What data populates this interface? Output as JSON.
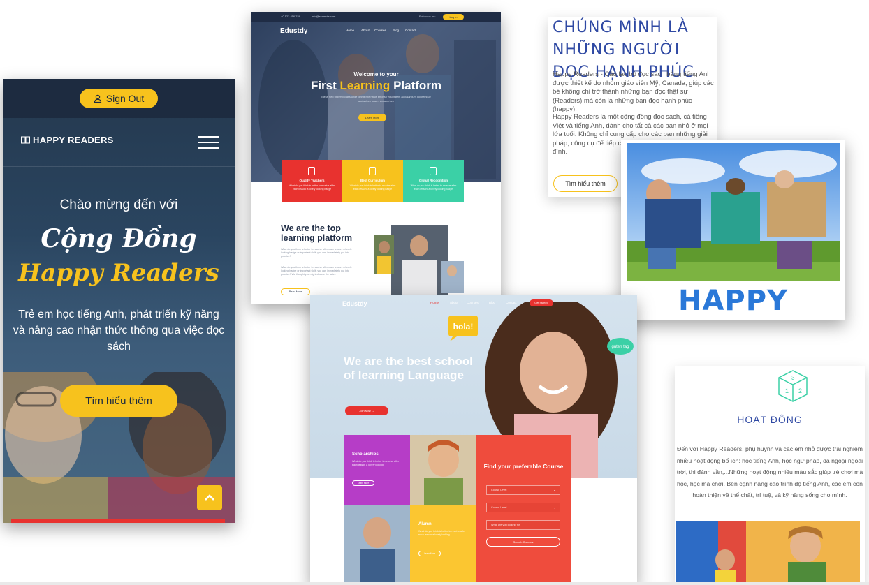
{
  "mobile": {
    "sign_out": "Sign Out",
    "logo": "HAPPY READERS",
    "welcome": "Chào mừng đến với",
    "headline_1": "Cộng Đồng",
    "headline_2": "Happy Readers",
    "description": "Trẻ em học tiếng Anh, phát triển kỹ năng và nâng cao nhận thức thông qua việc đọc sách",
    "cta": "Tìm hiểu thêm",
    "colors": {
      "navy": "#1d2b40",
      "yellow": "#f7c21d",
      "red": "#e8322f"
    },
    "icons": {
      "user": "user-icon",
      "menu": "hamburger-icon",
      "top": "chevron-up-icon"
    }
  },
  "edustdy1": {
    "phone": "+0 123 456 789",
    "email": "info@example.com",
    "follow": "Follow us on:",
    "login": "Log in",
    "brand": "Edustdy",
    "menu": [
      "Home",
      "About",
      "Courses",
      "Blog",
      "Contact"
    ],
    "hero_welcome": "Welcome to your",
    "hero_title_1": "First",
    "hero_title_2": "Learning",
    "hero_title_3": "Platform",
    "hero_text": "These Sed ut perspiciatis unde omnis iste natus error sit voluptatem accusantium doloremque laudantium totam rem aperiam",
    "hero_button": "Learn More",
    "features": [
      {
        "title": "Quality Teachers",
        "text": "What do you think is better to receive after each lesson: a lovely looking badge",
        "color": "#e8322f"
      },
      {
        "title": "Best Curriculum",
        "text": "What do you think is better to receive after each lesson: a lovely looking badge",
        "color": "#f7c21d"
      },
      {
        "title": "Global Recognition",
        "text": "What do you think is better to receive after each lesson: a lovely looking badge",
        "color": "#3bd0a6"
      }
    ],
    "section_title": "We are the top learning platform",
    "section_text_1": "What do you think is better to receive after each lesson: a lovely looking badge or important skills you can immediately put into practice?",
    "section_text_2": "What do you think is better to receive after each lesson: a lovely looking badge or important skills you can immediately put into practice? We thought you might choose the latter.",
    "read_more": "Read More"
  },
  "happy_text": {
    "title": "CHÚNG MÌNH LÀ NHỮNG NGƯỜI ĐỌC HẠNH PHÚC",
    "p1": "Happy Readers - Câu lạc bộ đọc sách bằng tiếng Anh được thiết kế do nhóm giáo viên Mỹ, Canada, giúp các bé không chỉ trở thành những bạn đọc thật sự (Readers) mà còn là những bạn đọc hạnh phúc (happy).",
    "p2": "Happy Readers là một cộng đồng đọc sách, cả tiếng Việt và tiếng Anh, dành cho tất cả các bạn nhỏ ở mọi lứa tuổi. Không chỉ cung cấp cho các bạn những giải pháp, công cụ để tiếp cậ HRs còn hướng đến là no đình.",
    "button": "Tìm hiểu thêm",
    "color": "#2f49a3"
  },
  "happy_photo": {
    "banner": "HAPPY READERS",
    "color": "#2a78d8"
  },
  "edustdy2": {
    "brand": "Edustdy",
    "menu": [
      "Home",
      "About",
      "Courses",
      "Blog",
      "Contact"
    ],
    "get_started": "Get Started",
    "hero_title": "We are the best school of learning Language",
    "join_button": "Join Now →",
    "hola": "hola!",
    "guten": "guten tag",
    "scholarships_title": "Scholarships",
    "scholarships_text": "What do you think is better to receive after each lesson a lovely looking",
    "learn_more": "Learn More",
    "alumni_title": "Alumni",
    "alumni_text": "What do you think is better to receive after each lesson a lovely looking",
    "find_title": "Find your preferable Course",
    "select_1": "Course Level",
    "select_2": "Course Level",
    "search_placeholder": "What are you looking for",
    "search_button": "Search Courses",
    "colors": {
      "purple": "#b63dc7",
      "yellow": "#fbc631",
      "red": "#ef4c3d"
    }
  },
  "activity": {
    "title": "HOẠT ĐỘNG",
    "text": "Đến với Happy Readers, phụ huynh và các em nhỏ được trải nghiệm nhiều hoạt động bổ ích: học tiếng Anh, học ngữ pháp, dã ngoại ngoài trời, thi đánh vần,...Những hoạt động nhiều màu sắc giúp trẻ chơi mà học, học mà chơi. Bên cạnh nâng cao trình độ tiếng Anh, các em còn hoàn thiện về thể chất, trí tuệ, và kỹ năng sống cho mình.",
    "icon": "cube-icon"
  }
}
